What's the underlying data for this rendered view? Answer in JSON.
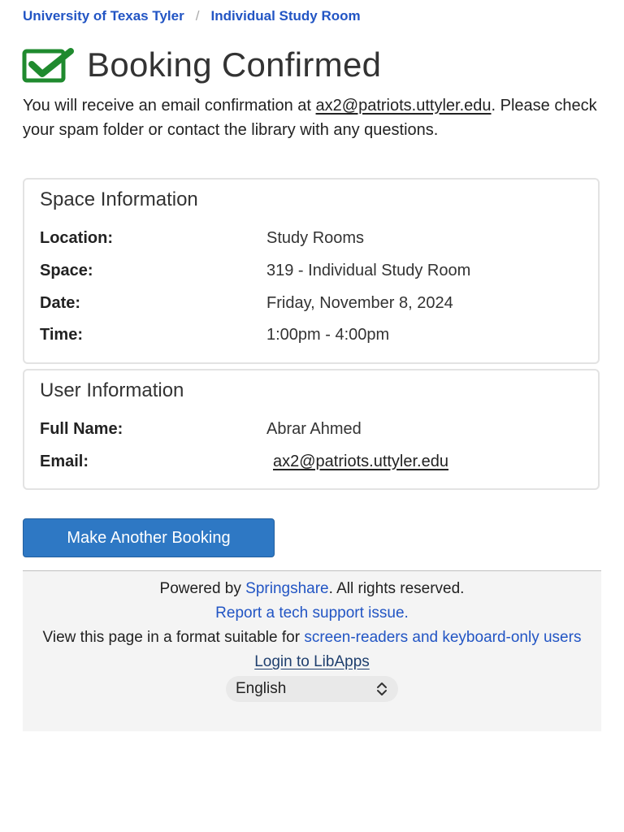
{
  "breadcrumb": {
    "items": [
      {
        "label": "University of Texas Tyler"
      },
      {
        "label": "Individual Study Room"
      }
    ],
    "separator": "/"
  },
  "header": {
    "title": "Booking Confirmed",
    "icon": "check-square-icon",
    "icon_color": "#1f8a2e"
  },
  "intro": {
    "text_before": "You will receive an email confirmation at ",
    "email": "ax2@patriots.uttyler.edu",
    "text_after": ". Please check your spam folder or contact the library with any questions."
  },
  "space_info": {
    "title": "Space Information",
    "rows": [
      {
        "label": "Location:",
        "value": "Study Rooms"
      },
      {
        "label": "Space:",
        "value": "319 - Individual Study Room"
      },
      {
        "label": "Date:",
        "value": "Friday, November 8, 2024"
      },
      {
        "label": "Time:",
        "value": "1:00pm - 4:00pm"
      }
    ]
  },
  "user_info": {
    "title": "User Information",
    "rows": [
      {
        "label": "Full Name:",
        "value": "Abrar Ahmed"
      },
      {
        "label": "Email:",
        "value": "ax2@patriots.uttyler.edu"
      }
    ]
  },
  "actions": {
    "another_booking_label": "Make Another Booking",
    "button_color": "#2e78c4"
  },
  "footer": {
    "powered_prefix": "Powered by ",
    "powered_link": "Springshare",
    "powered_suffix": ". All rights reserved.",
    "report_link": "Report a tech support issue.",
    "view_prefix": "View this page in a format suitable for ",
    "view_link": "screen-readers and keyboard-only users",
    "login_link": "Login to LibApps",
    "language": {
      "selected": "English"
    },
    "link_color": "#2255c4"
  }
}
